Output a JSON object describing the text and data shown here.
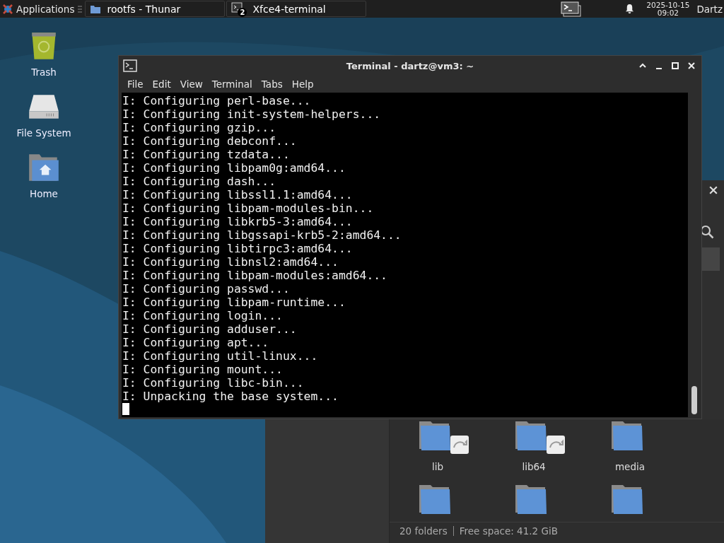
{
  "taskbar": {
    "apps_menu": "Applications",
    "tasks": [
      {
        "label": "rootfs - Thunar",
        "kind": "folder"
      },
      {
        "label": "Xfce4-terminal",
        "kind": "terminal",
        "badge": "2"
      }
    ],
    "clock": {
      "date": "2025-10-15",
      "time": "09:02"
    },
    "user": "Dartz"
  },
  "desktop_icons": [
    {
      "label": "Trash",
      "kind": "trash"
    },
    {
      "label": "File System",
      "kind": "drive"
    },
    {
      "label": "Home",
      "kind": "home"
    }
  ],
  "terminal": {
    "title": "Terminal - dartz@vm3: ~",
    "menu": [
      "File",
      "Edit",
      "View",
      "Terminal",
      "Tabs",
      "Help"
    ],
    "lines": [
      "I: Configuring perl-base...",
      "I: Configuring init-system-helpers...",
      "I: Configuring gzip...",
      "I: Configuring debconf...",
      "I: Configuring tzdata...",
      "I: Configuring libpam0g:amd64...",
      "I: Configuring dash...",
      "I: Configuring libssl1.1:amd64...",
      "I: Configuring libpam-modules-bin...",
      "I: Configuring libkrb5-3:amd64...",
      "I: Configuring libgssapi-krb5-2:amd64...",
      "I: Configuring libtirpc3:amd64...",
      "I: Configuring libnsl2:amd64...",
      "I: Configuring libpam-modules:amd64...",
      "I: Configuring passwd...",
      "I: Configuring libpam-runtime...",
      "I: Configuring login...",
      "I: Configuring adduser...",
      "I: Configuring apt...",
      "I: Configuring util-linux...",
      "I: Configuring mount...",
      "I: Configuring libc-bin...",
      "I: Unpacking the base system..."
    ]
  },
  "file_manager": {
    "folders": [
      {
        "name": "lib",
        "kind": "link"
      },
      {
        "name": "lib64",
        "kind": "link"
      },
      {
        "name": "media",
        "kind": "plain"
      },
      {
        "kind": "plain"
      },
      {
        "kind": "plain"
      },
      {
        "kind": "plain"
      }
    ],
    "status": {
      "count": "20 folders",
      "free_space": "Free space: 41.2 GiB"
    }
  }
}
